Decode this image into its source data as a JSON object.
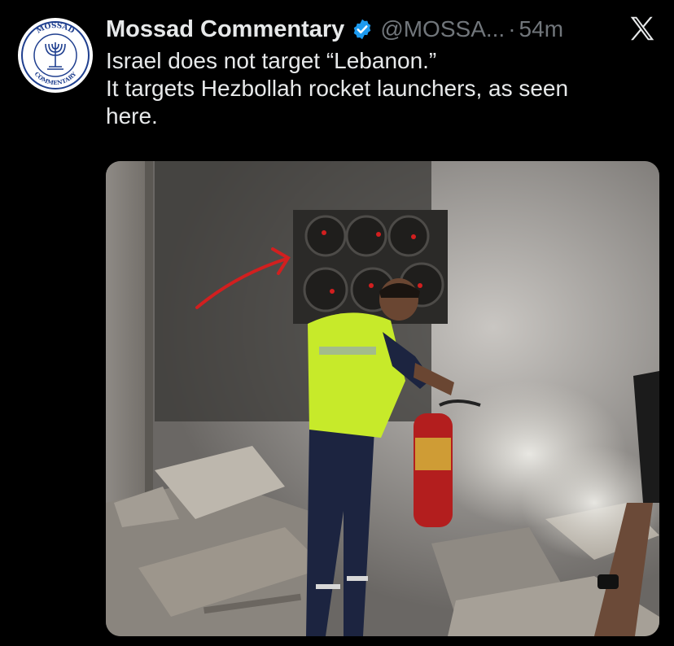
{
  "author": {
    "name": "Mossad Commentary",
    "handle": "@MOSSA...",
    "separator": "·",
    "time": "54m",
    "avatar_top_text": "MOSSAD",
    "avatar_bottom_text": "COMMENTARY",
    "verified_color": "#1d9bf0"
  },
  "tweet": {
    "lines": [
      "Israel does not target “Lebanon.”",
      "It targets Hezbollah rocket launchers, as seen",
      "here."
    ]
  },
  "icons": {
    "platform": "x-logo-icon",
    "verified": "verified-badge-icon"
  },
  "colors": {
    "background": "#000000",
    "text": "#e7e9ea",
    "muted": "#71767b",
    "annotation_red": "#d21f1f"
  }
}
